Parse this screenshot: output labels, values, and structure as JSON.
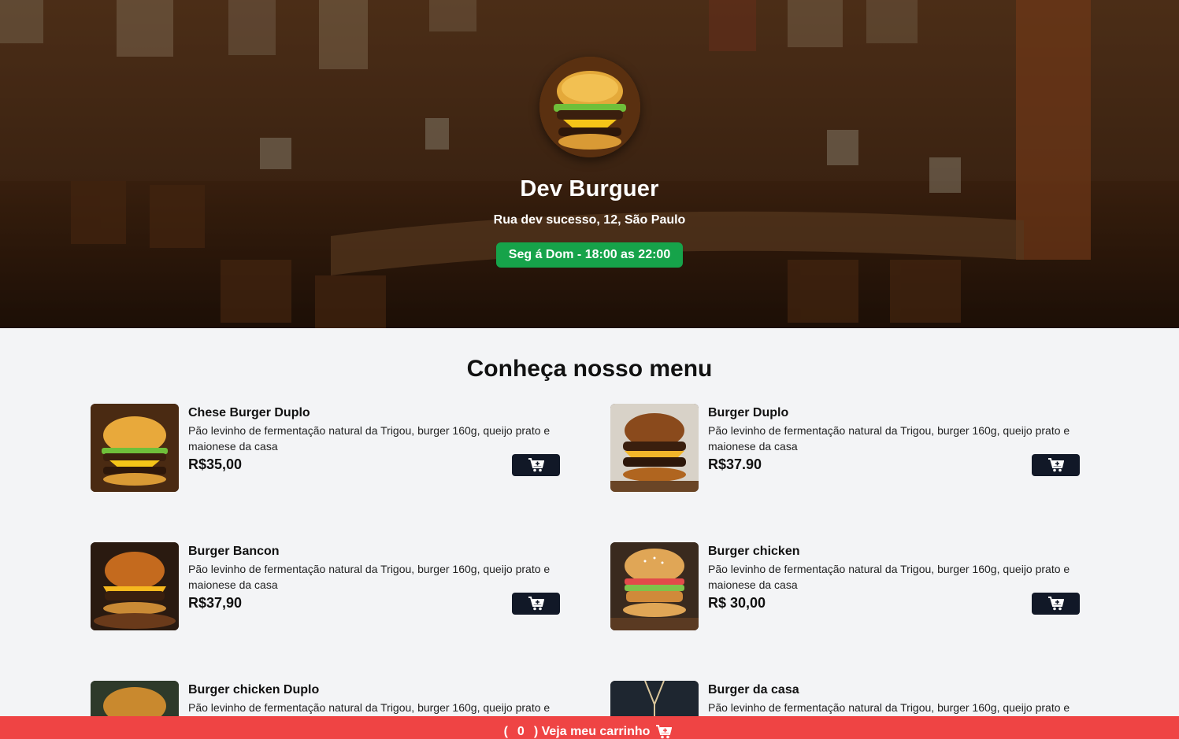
{
  "hero": {
    "brand": "Dev Burguer",
    "address": "Rua dev sucesso, 12, São Paulo",
    "hours": "Seg á Dom - 18:00 as 22:00"
  },
  "menu": {
    "title": "Conheça nosso menu",
    "items": [
      {
        "name": "Chese Burger Duplo",
        "description": "Pão levinho de fermentação natural da Trigou, burger 160g, queijo prato e maionese da casa",
        "price": "R$35,00"
      },
      {
        "name": "Burger Duplo",
        "description": "Pão levinho de fermentação natural da Trigou, burger 160g, queijo prato e maionese da casa",
        "price": "R$37.90"
      },
      {
        "name": "Burger Bancon",
        "description": "Pão levinho de fermentação natural da Trigou, burger 160g, queijo prato e maionese da casa",
        "price": "R$37,90"
      },
      {
        "name": "Burger chicken",
        "description": "Pão levinho de fermentação natural da Trigou, burger 160g, queijo prato e maionese da casa",
        "price": "R$ 30,00"
      },
      {
        "name": "Burger chicken Duplo",
        "description": "Pão levinho de fermentação natural da Trigou, burger 160g, queijo prato e maionese da casa",
        "price": ""
      },
      {
        "name": "Burger da casa",
        "description": "Pão levinho de fermentação natural da Trigou, burger 160g, queijo prato e maionese da casa",
        "price": ""
      }
    ]
  },
  "cart": {
    "open": "(",
    "count": "0",
    "label": ") Veja meu carrinho"
  },
  "colors": {
    "hours_badge": "#16a34a",
    "add_button": "#111827",
    "cart_bar": "#ef4444"
  },
  "icons": {
    "add_to_cart": "cart-plus-icon",
    "cart": "cart-plus-icon"
  }
}
